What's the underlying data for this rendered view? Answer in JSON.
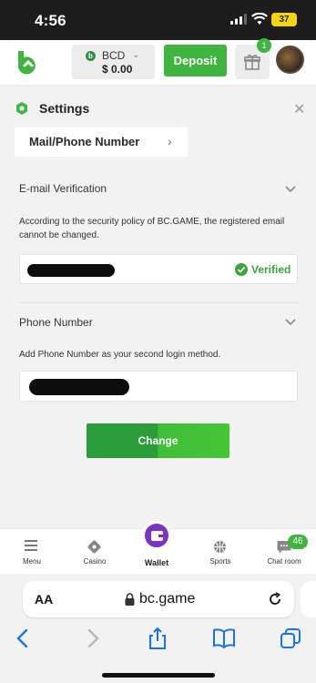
{
  "status_bar": {
    "time": "4:56",
    "battery": "37"
  },
  "header": {
    "currency_code": "BCD",
    "balance": "$ 0.00",
    "deposit_label": "Deposit",
    "gift_badge_count": "1",
    "colors": {
      "brand_green": "#3fb53f"
    }
  },
  "settings": {
    "title": "Settings",
    "active_tab": "Mail/Phone Number",
    "email_section": {
      "title": "E-mail Verification",
      "description": "According to the security policy of BC.GAME, the registered email cannot be changed.",
      "status": "Verified"
    },
    "phone_section": {
      "title": "Phone Number",
      "description": "Add Phone Number as your second login method."
    },
    "change_button": "Change"
  },
  "bottom_nav": {
    "items": [
      {
        "label": "Menu",
        "icon": "menu-icon"
      },
      {
        "label": "Casino",
        "icon": "casino-icon"
      },
      {
        "label": "Wallet",
        "icon": "wallet-icon"
      },
      {
        "label": "Sports",
        "icon": "sports-ball-icon"
      },
      {
        "label": "Chat room",
        "icon": "chat-icon"
      }
    ],
    "chat_badge": "46",
    "wallet_color": "#7a32c8"
  },
  "browser": {
    "text_size_label": "AA",
    "url": "bc.game"
  }
}
